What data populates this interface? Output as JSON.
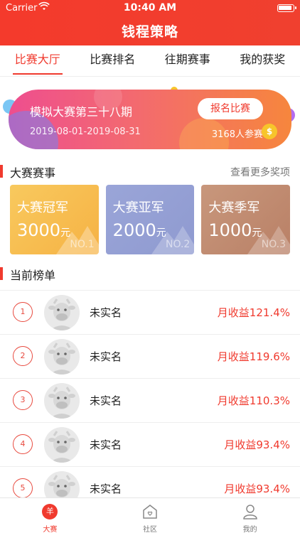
{
  "status": {
    "carrier": "Carrier",
    "time": "10:40 AM"
  },
  "header": {
    "title": "钱程策略"
  },
  "tabs": [
    {
      "label": "比赛大厅",
      "active": true
    },
    {
      "label": "比赛排名",
      "active": false
    },
    {
      "label": "往期赛事",
      "active": false
    },
    {
      "label": "我的获奖",
      "active": false
    }
  ],
  "banner": {
    "name": "模拟大赛第三十八期",
    "date_range": "2019-08-01-2019-08-31",
    "participants": "3168人参赛",
    "signup_label": "报名比赛",
    "coin_symbol": "$"
  },
  "events_section": {
    "title": "大赛赛事",
    "more_label": "查看更多奖项"
  },
  "prizes": [
    {
      "name": "大赛冠军",
      "amount": "3000",
      "unit": "元",
      "rank": "NO.1"
    },
    {
      "name": "大赛亚军",
      "amount": "2000",
      "unit": "元",
      "rank": "NO.2"
    },
    {
      "name": "大赛季军",
      "amount": "1000",
      "unit": "元",
      "rank": "NO.3"
    }
  ],
  "ranking_section": {
    "title": "当前榜单"
  },
  "ranking": [
    {
      "rank": "1",
      "name": "未实名",
      "gain": "月收益121.4%"
    },
    {
      "rank": "2",
      "name": "未实名",
      "gain": "月收益119.6%"
    },
    {
      "rank": "3",
      "name": "未实名",
      "gain": "月收益110.3%"
    },
    {
      "rank": "4",
      "name": "未实名",
      "gain": "月收益93.4%"
    },
    {
      "rank": "5",
      "name": "未实名",
      "gain": "月收益93.4%"
    }
  ],
  "tabbar": [
    {
      "label": "大赛",
      "icon": "yuan-icon",
      "icon_glyph": "羊",
      "active": true
    },
    {
      "label": "社区",
      "icon": "community-icon",
      "active": false
    },
    {
      "label": "我的",
      "icon": "profile-icon",
      "active": false
    }
  ],
  "colors": {
    "brand": "#f03a2e"
  }
}
